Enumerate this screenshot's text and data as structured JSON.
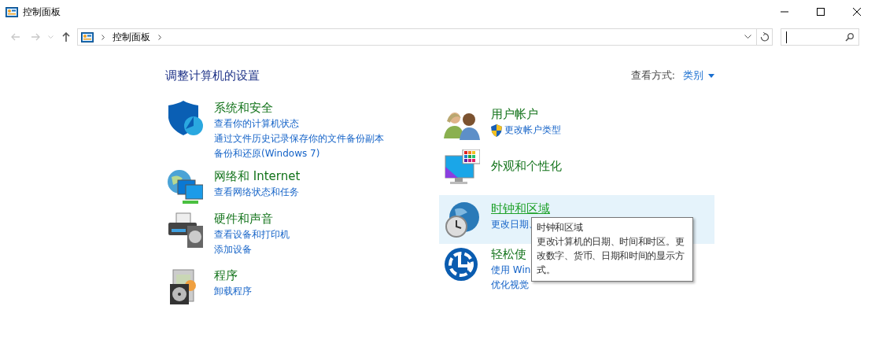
{
  "window": {
    "title": "控制面板"
  },
  "address_bar": {
    "crumbs": [
      "控制面板"
    ]
  },
  "search": {
    "focused": true
  },
  "heading": "调整计算机的设置",
  "view_by": {
    "label": "查看方式:",
    "value": "类别"
  },
  "columns": [
    {
      "categories": [
        {
          "title": "系统和安全",
          "hovered": false,
          "links": [
            {
              "text": "查看你的计算机状态"
            },
            {
              "text": "通过文件历史记录保存你的文件备份副本"
            },
            {
              "text": "备份和还原(Windows 7)"
            }
          ]
        },
        {
          "title": "网络和 Internet",
          "hovered": false,
          "links": [
            {
              "text": "查看网络状态和任务"
            }
          ]
        },
        {
          "title": "硬件和声音",
          "hovered": false,
          "links": [
            {
              "text": "查看设备和打印机"
            },
            {
              "text": "添加设备"
            }
          ]
        },
        {
          "title": "程序",
          "hovered": false,
          "links": [
            {
              "text": "卸载程序"
            }
          ]
        }
      ]
    },
    {
      "categories": [
        {
          "title": "用户帐户",
          "hovered": false,
          "links": [
            {
              "text": "更改帐户类型",
              "kind": "shield"
            }
          ]
        },
        {
          "title": "外观和个性化",
          "hovered": false
        },
        {
          "title": "时钟和区域",
          "hovered": true,
          "links": [
            {
              "text": "更改日期、"
            }
          ]
        },
        {
          "title": "轻松使",
          "hovered": false,
          "links": [
            {
              "text": "使用 Win"
            },
            {
              "text": "优化视觉"
            }
          ]
        }
      ]
    }
  ],
  "tooltip": {
    "title": "时钟和区域",
    "text": "更改计算机的日期、时间和时区。更改数字、货币、日期和时间的显示方式。"
  }
}
